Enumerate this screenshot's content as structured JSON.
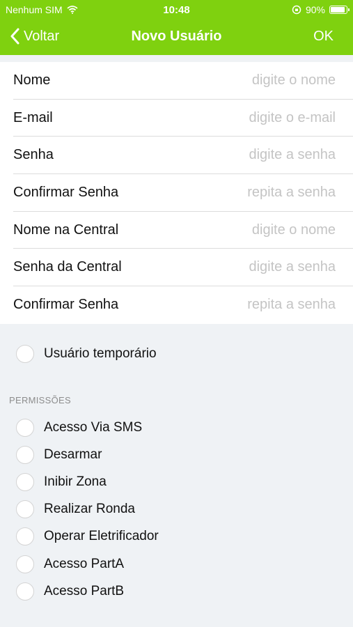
{
  "status": {
    "carrier": "Nenhum SIM",
    "time": "10:48",
    "battery": "90%"
  },
  "nav": {
    "back_label": "Voltar",
    "title": "Novo Usuário",
    "ok_label": "OK"
  },
  "form": {
    "fields": [
      {
        "label": "Nome",
        "placeholder": "digite o nome",
        "value": ""
      },
      {
        "label": "E-mail",
        "placeholder": "digite o e-mail",
        "value": ""
      },
      {
        "label": "Senha",
        "placeholder": "digite a senha",
        "value": ""
      },
      {
        "label": "Confirmar Senha",
        "placeholder": "repita a senha",
        "value": ""
      },
      {
        "label": "Nome na Central",
        "placeholder": "digite o nome",
        "value": ""
      },
      {
        "label": "Senha da Central",
        "placeholder": "digite a senha",
        "value": ""
      },
      {
        "label": "Confirmar Senha",
        "placeholder": "repita a senha",
        "value": ""
      }
    ]
  },
  "temporary": {
    "label": "Usuário temporário",
    "checked": false
  },
  "permissions": {
    "header": "PERMISSÕES",
    "items": [
      {
        "label": "Acesso Via SMS",
        "checked": false
      },
      {
        "label": "Desarmar",
        "checked": false
      },
      {
        "label": "Inibir Zona",
        "checked": false
      },
      {
        "label": "Realizar Ronda",
        "checked": false
      },
      {
        "label": "Operar Eletrificador",
        "checked": false
      },
      {
        "label": "Acesso PartA",
        "checked": false
      },
      {
        "label": "Acesso PartB",
        "checked": false
      }
    ]
  },
  "colors": {
    "brand": "#7fd10f",
    "background": "#eff2f5",
    "placeholder": "#c4c4c4",
    "section_header": "#8d8d8d"
  },
  "icons": {
    "wifi": "wifi-icon",
    "back": "chevron-left-icon",
    "lock_rotation": "orientation-lock-icon",
    "battery": "battery-icon",
    "checkbox": "circle-checkbox-icon"
  }
}
